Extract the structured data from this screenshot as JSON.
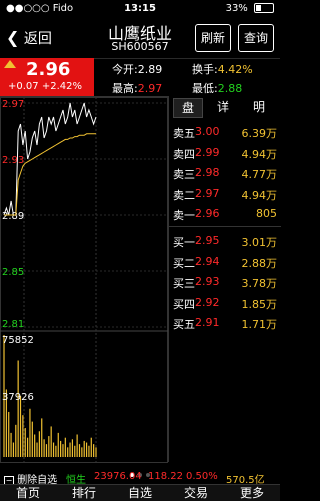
{
  "status": {
    "carrier": "●●○○○ Fido",
    "time": "13:15",
    "battery": "33%",
    "battery_level": 0.33
  },
  "nav": {
    "back_label": "返回",
    "title": "山鹰纸业",
    "code": "SH600567",
    "refresh_label": "刷新",
    "query_label": "查询"
  },
  "quote": {
    "price": "2.96",
    "change": "+0.07 +2.42%",
    "open_label": "今开:",
    "open_value": "2.89",
    "high_label": "最高:",
    "high_value": "2.97",
    "turnover_label": "换手:",
    "turnover_value": "4.42%",
    "low_label": "最低:",
    "low_value": "2.88"
  },
  "book": {
    "tabs": [
      "盘",
      "详",
      "明"
    ],
    "rows": [
      {
        "label": "卖五",
        "price": "3.00",
        "volume": "6.39万"
      },
      {
        "label": "卖四",
        "price": "2.99",
        "volume": "4.94万"
      },
      {
        "label": "卖三",
        "price": "2.98",
        "volume": "4.77万"
      },
      {
        "label": "卖二",
        "price": "2.97",
        "volume": "4.94万"
      },
      {
        "label": "卖一",
        "price": "2.96",
        "volume": "805"
      },
      {
        "label": "买一",
        "price": "2.95",
        "volume": "3.01万"
      },
      {
        "label": "买二",
        "price": "2.94",
        "volume": "2.88万"
      },
      {
        "label": "买三",
        "price": "2.93",
        "volume": "3.78万"
      },
      {
        "label": "买四",
        "price": "2.92",
        "volume": "1.85万"
      },
      {
        "label": "买五",
        "price": "2.91",
        "volume": "1.71万"
      }
    ]
  },
  "chart_data": {
    "type": "line",
    "price_axis_labels": [
      "2.97",
      "2.93",
      "2.89",
      "2.85",
      "2.81"
    ],
    "volume_axis_labels": [
      "75852",
      "37926"
    ],
    "ylim": [
      2.81,
      2.97
    ],
    "volume_max": 75852,
    "series": [
      {
        "values": [
          2.89,
          2.895,
          2.89,
          2.9,
          2.89,
          2.89,
          2.95,
          2.955,
          2.94,
          2.95,
          2.93,
          2.935,
          2.945,
          2.95,
          2.94,
          2.955,
          2.96,
          2.945,
          2.95,
          2.96,
          2.955,
          2.96,
          2.95,
          2.955,
          2.96,
          2.965,
          2.955,
          2.96,
          2.97,
          2.96,
          2.965,
          2.955,
          2.96,
          2.965,
          2.97,
          2.96,
          2.965,
          2.96,
          2.955,
          2.96
        ]
      },
      {
        "values": [
          2.89,
          2.89,
          2.89,
          2.89,
          2.89,
          2.89,
          2.915,
          2.92,
          2.925,
          2.927,
          2.928,
          2.929,
          2.93,
          2.931,
          2.932,
          2.933,
          2.934,
          2.935,
          2.936,
          2.937,
          2.938,
          2.939,
          2.94,
          2.941,
          2.942,
          2.943,
          2.944,
          2.944,
          2.945,
          2.945,
          2.946,
          2.946,
          2.947,
          2.947,
          2.947,
          2.948,
          2.948,
          2.948,
          2.948,
          2.948
        ]
      }
    ],
    "volume": [
      75852,
      42000,
      28000,
      15000,
      9000,
      20000,
      60000,
      38000,
      26000,
      18000,
      12000,
      30000,
      22000,
      14000,
      9000,
      16000,
      24000,
      11000,
      8000,
      13000,
      19000,
      9000,
      7000,
      15000,
      10000,
      8000,
      12000,
      6000,
      9000,
      11000,
      7000,
      14000,
      8000,
      6000,
      10000,
      9000,
      7000,
      12000,
      8000,
      6000
    ]
  },
  "pager": {
    "pages": 3,
    "current": 0
  },
  "index": {
    "action_label": "删除自选",
    "name": "恒生",
    "value": "23976.04",
    "change": "118.22",
    "percent": "0.50%",
    "amount": "570.5亿"
  },
  "bottom_tabs": [
    "首页",
    "排行",
    "自选",
    "交易",
    "更多"
  ]
}
